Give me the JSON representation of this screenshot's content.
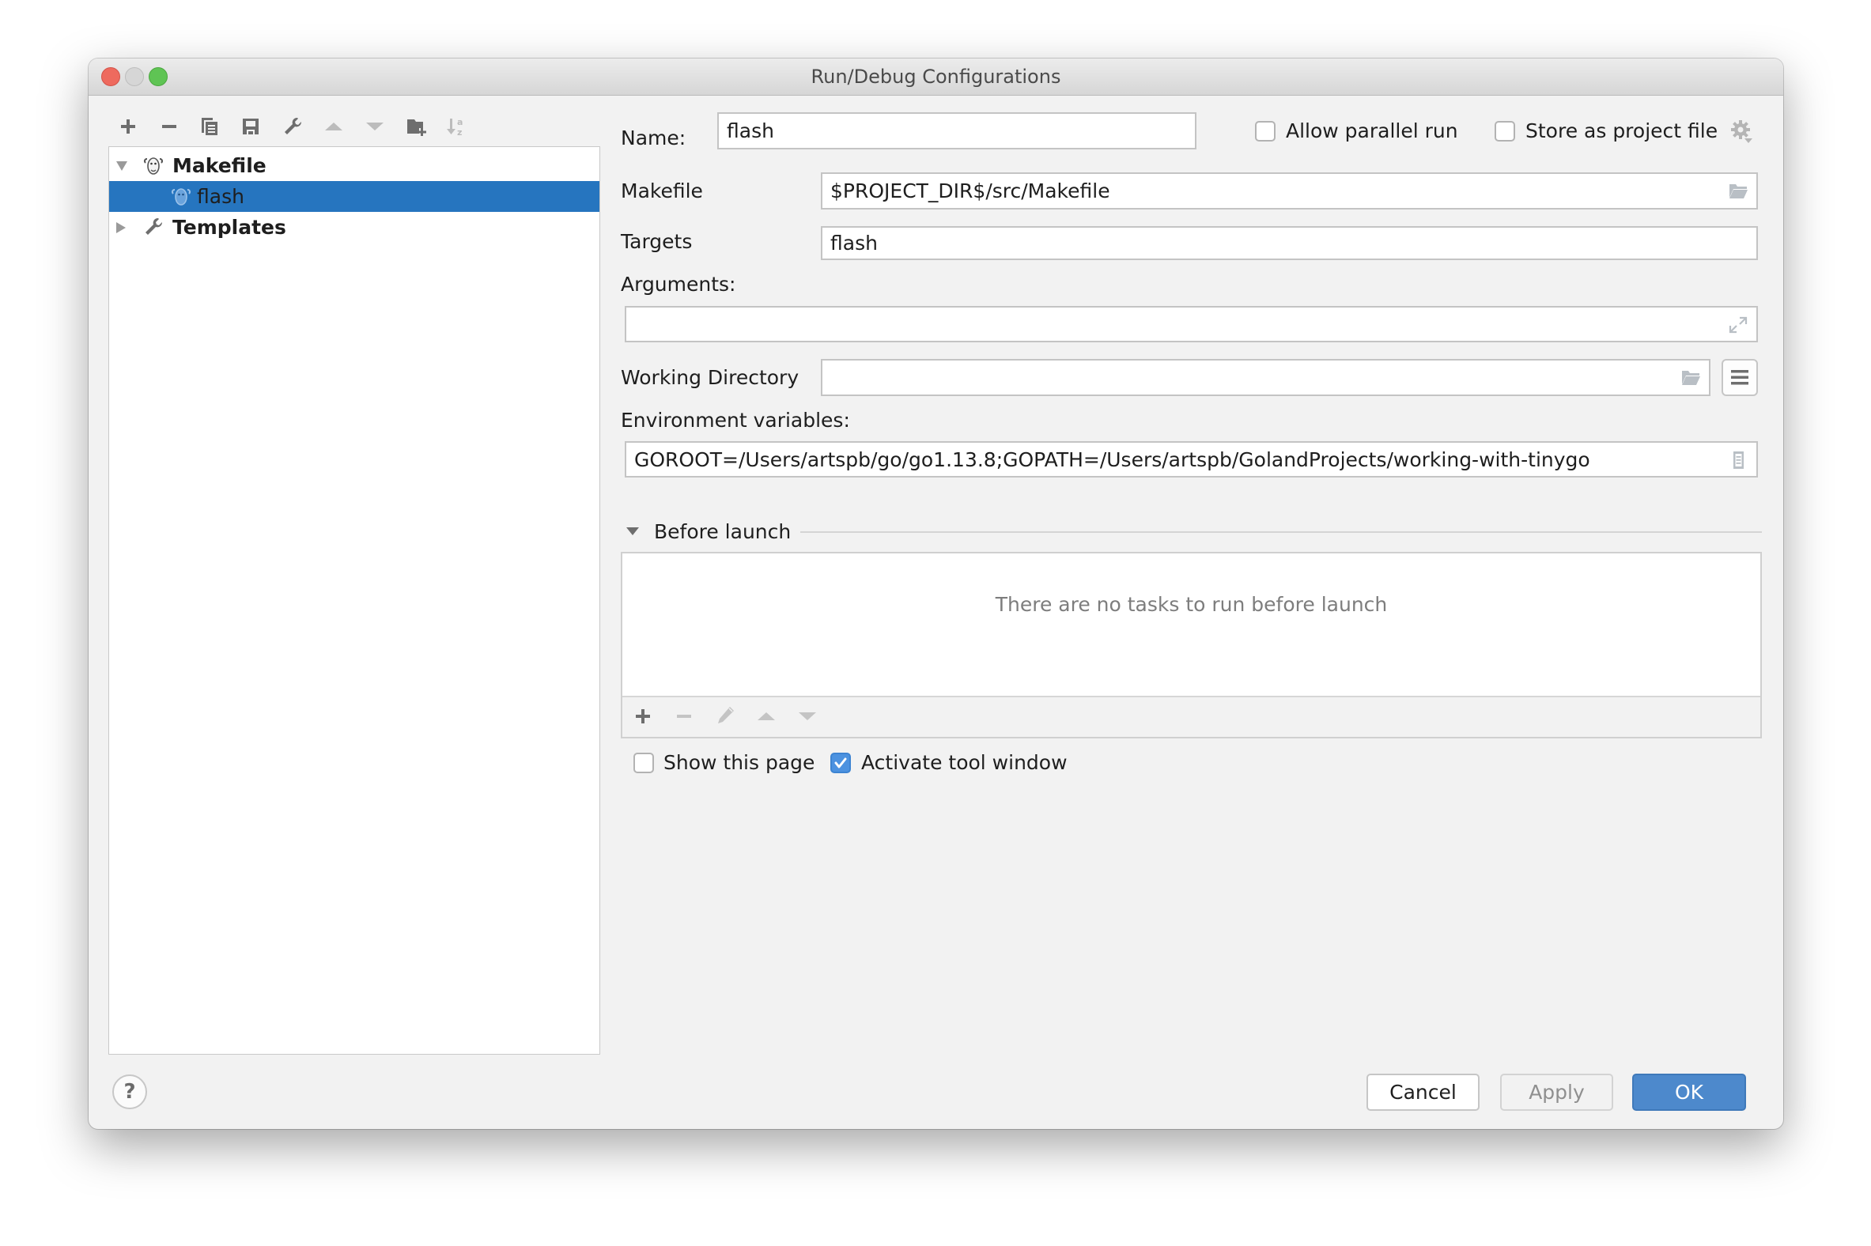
{
  "window": {
    "title": "Run/Debug Configurations",
    "traffic_lights": [
      "close",
      "minimize",
      "maximize"
    ]
  },
  "tree_toolbar": {
    "icons": [
      {
        "name": "plus-icon",
        "enabled": true
      },
      {
        "name": "minus-icon",
        "enabled": true
      },
      {
        "name": "copy-icon",
        "enabled": true
      },
      {
        "name": "save-icon",
        "enabled": true
      },
      {
        "name": "wrench-icon",
        "enabled": true
      },
      {
        "name": "move-up-icon",
        "enabled": false
      },
      {
        "name": "move-down-icon",
        "enabled": false
      },
      {
        "name": "new-folder-icon",
        "enabled": true
      },
      {
        "name": "sort-alpha-icon",
        "enabled": false
      }
    ]
  },
  "tree": {
    "items": [
      {
        "label": "Makefile",
        "icon": "gnu-icon",
        "expanded": true,
        "level": 0
      },
      {
        "label": "flash",
        "icon": "gnu-icon",
        "selected": true,
        "level": 1
      },
      {
        "label": "Templates",
        "icon": "wrench-icon",
        "expanded": false,
        "level": 0
      }
    ]
  },
  "form": {
    "name_label": "Name:",
    "name_value": "flash",
    "allow_parallel_label": "Allow parallel run",
    "allow_parallel_checked": false,
    "store_project_label": "Store as project file",
    "store_project_checked": false,
    "makefile_label": "Makefile",
    "makefile_value": "$PROJECT_DIR$/src/Makefile",
    "targets_label": "Targets",
    "targets_value": "flash",
    "arguments_label": "Arguments:",
    "arguments_value": "",
    "working_dir_label": "Working Directory",
    "working_dir_value": "",
    "env_label": "Environment variables:",
    "env_value": "GOROOT=/Users/artspb/go/go1.13.8;GOPATH=/Users/artspb/GolandProjects/working-with-tinygo"
  },
  "before_launch": {
    "title": "Before launch",
    "empty_text": "There are no tasks to run before launch",
    "toolbar": [
      {
        "name": "add-task-icon",
        "enabled": true
      },
      {
        "name": "remove-task-icon",
        "enabled": false
      },
      {
        "name": "edit-task-icon",
        "enabled": false
      },
      {
        "name": "move-task-up-icon",
        "enabled": false
      },
      {
        "name": "move-task-down-icon",
        "enabled": false
      }
    ],
    "show_page_label": "Show this page",
    "show_page_checked": false,
    "activate_tool_label": "Activate tool window",
    "activate_tool_checked": true
  },
  "buttons": {
    "help": "?",
    "cancel": "Cancel",
    "apply": "Apply",
    "ok": "OK"
  },
  "colors": {
    "selection": "#2675bf",
    "accent": "#4d89cc",
    "checkbox_checked": "#4c92e0"
  }
}
